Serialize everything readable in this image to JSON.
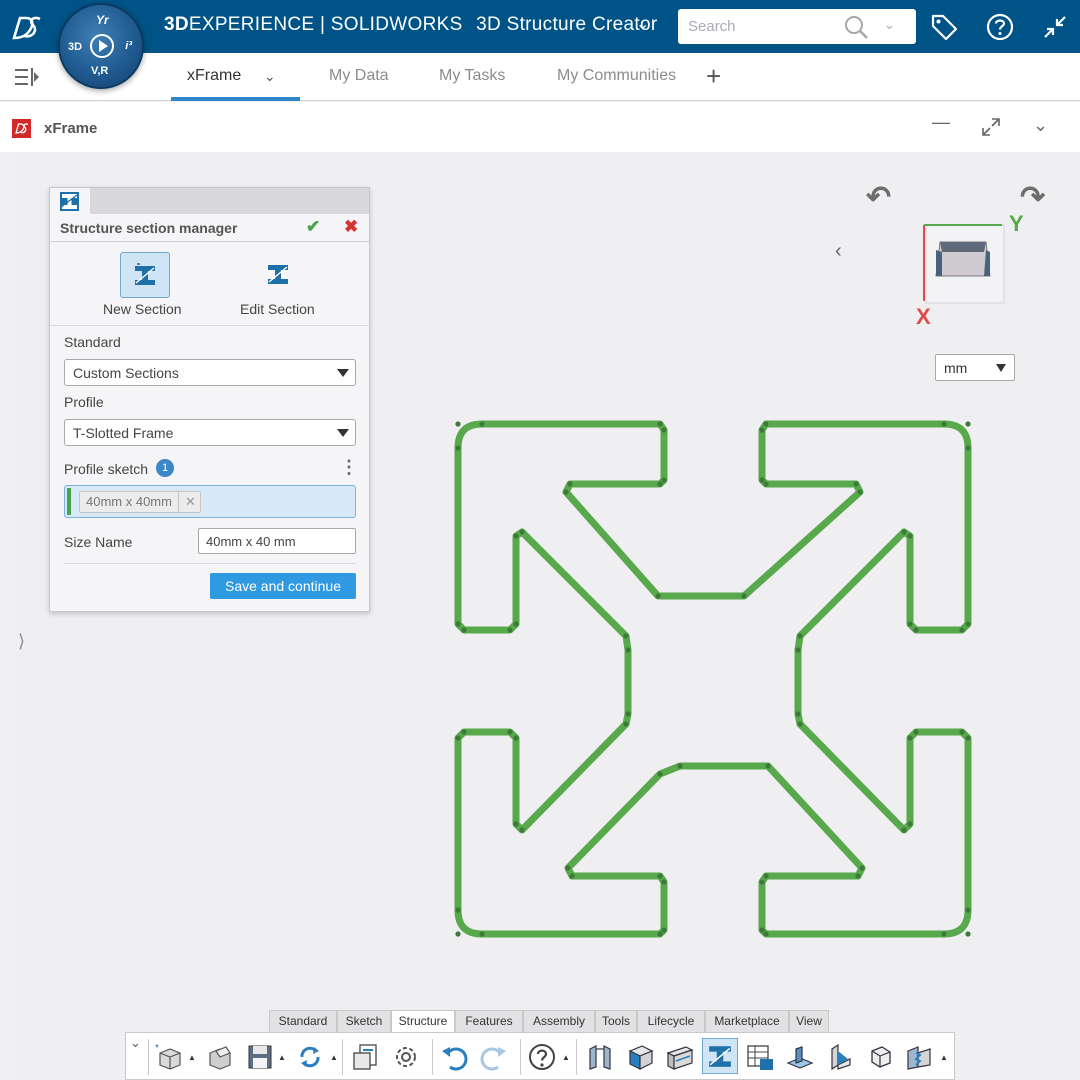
{
  "header": {
    "brand_bold": "3D",
    "brand_rest": "EXPERIENCE | SOLIDWORKS",
    "app_name": "3D Structure Creator",
    "compass": {
      "top": "Yr",
      "left": "3D",
      "right": "i³",
      "bottom": "V,R"
    },
    "search_placeholder": "Search"
  },
  "tabs": [
    {
      "label": "xFrame",
      "active": true
    },
    {
      "label": "My Data",
      "active": false
    },
    {
      "label": "My Tasks",
      "active": false
    },
    {
      "label": "My Communities",
      "active": false
    }
  ],
  "widget": {
    "title": "xFrame"
  },
  "panel": {
    "title": "Structure section manager",
    "new_section_label": "New Section",
    "edit_section_label": "Edit Section",
    "standard_label": "Standard",
    "standard_value": "Custom Sections",
    "profile_label": "Profile",
    "profile_value": "T-Slotted Frame",
    "profile_sketch_label": "Profile sketch",
    "profile_sketch_count": "1",
    "sketch_chip": "40mm x 40mm",
    "size_name_label": "Size Name",
    "size_name_value": "40mm x 40 mm",
    "save_button": "Save and continue"
  },
  "view": {
    "axis_x": "X",
    "axis_y": "Y",
    "unit_value": "mm",
    "profile_color": "#58a84c"
  },
  "toolbar": {
    "tabs": [
      "Standard",
      "Sketch",
      "Structure",
      "Features",
      "Assembly",
      "Tools",
      "Lifecycle",
      "Marketplace",
      "View"
    ],
    "active_tab": "Structure"
  },
  "colors": {
    "header_blue": "#005386",
    "accent_blue": "#2f86c8",
    "button_blue": "#2f9ae1",
    "ok_green": "#4aa34a",
    "cancel_red": "#d23434"
  }
}
